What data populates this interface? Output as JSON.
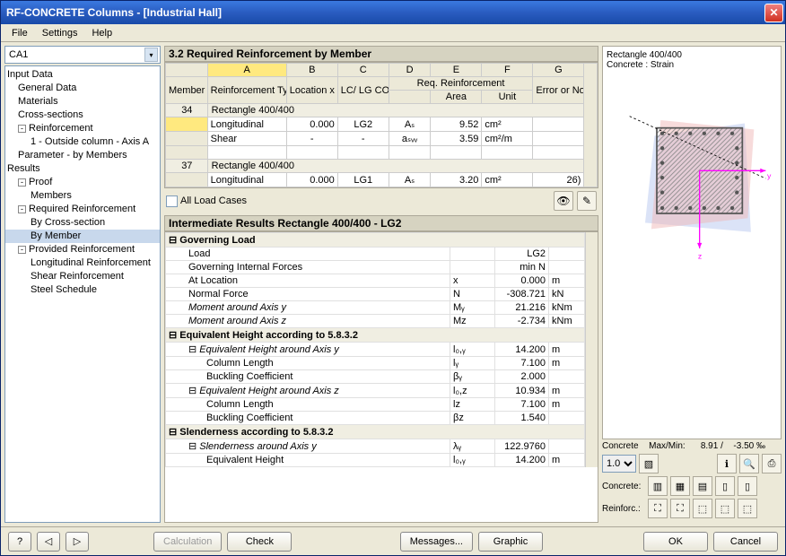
{
  "title": "RF-CONCRETE Columns - [Industrial Hall]",
  "menu": [
    "File",
    "Settings",
    "Help"
  ],
  "caseCombo": "CA1",
  "tree": {
    "inputData": "Input Data",
    "generalData": "General Data",
    "materials": "Materials",
    "crossSections": "Cross-sections",
    "reinforcement": "Reinforcement",
    "reinf1": "1 - Outside column - Axis A",
    "paramByMembers": "Parameter - by Members",
    "results": "Results",
    "proof": "Proof",
    "members": "Members",
    "reqReinf": "Required Reinforcement",
    "byCross": "By Cross-section",
    "byMember": "By Member",
    "provReinf": "Provided Reinforcement",
    "longReinf": "Longitudinal Reinforcement",
    "shearReinf": "Shear Reinforcement",
    "steelSched": "Steel Schedule"
  },
  "section": {
    "title": "3.2 Required Reinforcement by Member"
  },
  "cols": {
    "A": "A",
    "B": "B",
    "C": "C",
    "D": "D",
    "E": "E",
    "F": "F",
    "G": "G",
    "memberNo": "Member No",
    "reinfType": "Reinforcement Type",
    "loc": "Location x [m]",
    "lc": "LC/ LG CO",
    "reqReinf": "Req. Reinforcement",
    "area": "Area",
    "unit": "Unit",
    "err": "Error or Notice"
  },
  "rows": [
    {
      "no": "34",
      "sub": "Rectangle 400/400"
    },
    {
      "type": "Longitudinal",
      "loc": "0.000",
      "lc": "LG2",
      "d": "Aₛ",
      "area": "9.52",
      "unit": "cm²",
      "err": ""
    },
    {
      "type": "Shear",
      "loc": "-",
      "lc": "-",
      "d": "aₛᵥᵥ",
      "area": "3.59",
      "unit": "cm²/m",
      "err": ""
    },
    {
      "blank": true
    },
    {
      "no": "37",
      "sub": "Rectangle 400/400"
    },
    {
      "type": "Longitudinal",
      "loc": "0.000",
      "lc": "LG1",
      "d": "Aₛ",
      "area": "3.20",
      "unit": "cm²",
      "err": "26)"
    }
  ],
  "allLoadCases": "All Load Cases",
  "interTitle": "Intermediate Results Rectangle 400/400 - LG2",
  "inter": {
    "govLoad": "Governing Load",
    "load": "Load",
    "loadV": "LG2",
    "gif": "Governing Internal Forces",
    "gifV": "min N",
    "atLoc": "At Location",
    "atLocS": "x",
    "atLocV": "0.000",
    "atLocU": "m",
    "nForce": "Normal Force",
    "nForceS": "N",
    "nForceV": "-308.721",
    "nForceU": "kN",
    "my": "Moment around Axis y",
    "myS": "Mᵧ",
    "myV": "21.216",
    "myU": "kNm",
    "mz": "Moment around Axis z",
    "mzS": "Mᴢ",
    "mzV": "-2.734",
    "mzU": "kNm",
    "eqH": "Equivalent Height according to 5.8.3.2",
    "eqHy": "Equivalent Height around Axis y",
    "eqHyS": "l₀,ᵧ",
    "eqHyV": "14.200",
    "eqHyU": "m",
    "colLen": "Column Length",
    "colLenS": "lᵧ",
    "colLenV": "7.100",
    "colLenU": "m",
    "buckC": "Buckling Coefficient",
    "buckCS": "βᵧ",
    "buckCV": "2.000",
    "eqHz": "Equivalent Height around Axis z",
    "eqHzS": "l₀,ᴢ",
    "eqHzV": "10.934",
    "eqHzU": "m",
    "colLenZ": "Column Length",
    "colLenZS": "lᴢ",
    "colLenZV": "7.100",
    "colLenZU": "m",
    "buckCZ": "Buckling Coefficient",
    "buckCZS": "βᴢ",
    "buckCZV": "1.540",
    "slend": "Slenderness according to 5.8.3.2",
    "slendY": "Slenderness around Axis y",
    "slendYS": "λᵧ",
    "slendYV": "122.9760",
    "eqHt": "Equivalent Height",
    "eqHtS": "l₀,ᵧ",
    "eqHtV": "14.200",
    "eqHtU": "m"
  },
  "rightPanel": {
    "line1": "Rectangle 400/400",
    "line2": "Concrete : Strain",
    "concreteLbl": "Concrete",
    "maxmin": "Max/Min:",
    "maxv": "8.91 /",
    "minv": "-3.50 ‰",
    "spin": "1.0",
    "concreteRow": "Concrete:",
    "reinfRow": "Reinforc.:"
  },
  "buttons": {
    "calc": "Calculation",
    "check": "Check",
    "messages": "Messages...",
    "graphic": "Graphic",
    "ok": "OK",
    "cancel": "Cancel"
  }
}
